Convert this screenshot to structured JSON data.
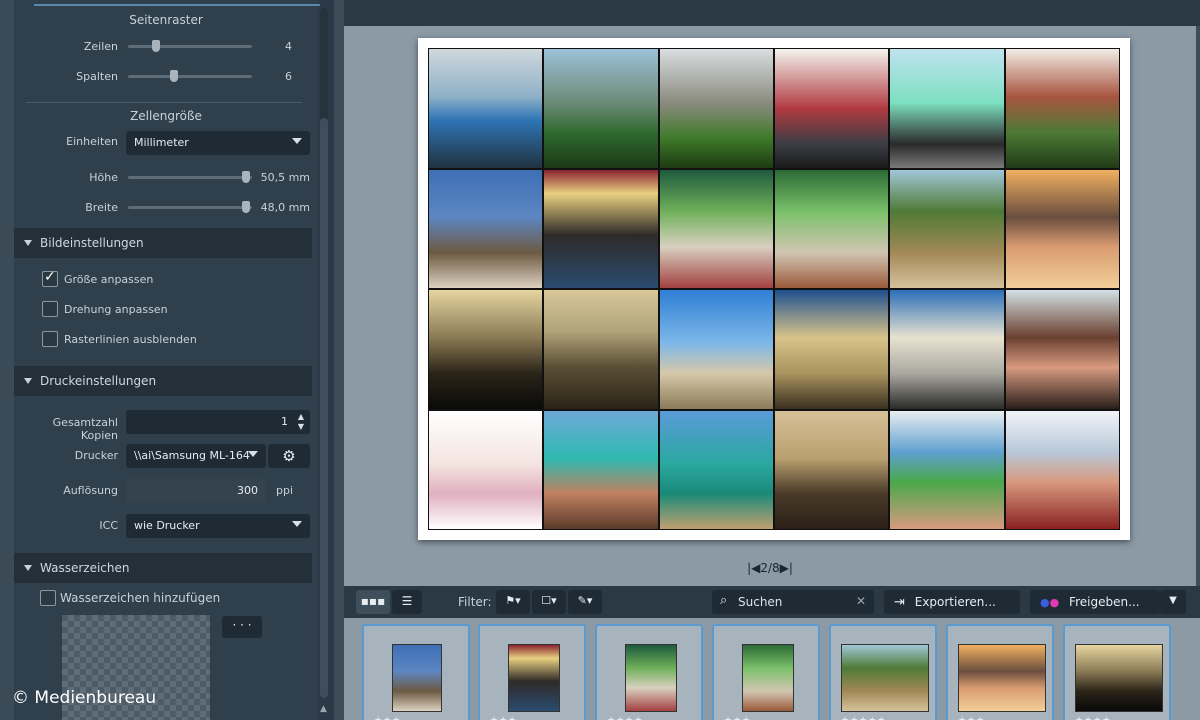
{
  "sidebar": {
    "raster_title": "Seitenraster",
    "rows_label": "Zeilen",
    "rows_value": "4",
    "rows_level": 0.2,
    "cols_label": "Spalten",
    "cols_value": "6",
    "cols_level": 0.35,
    "cellsize_title": "Zellengröße",
    "units_label": "Einheiten",
    "units_value": "Millimeter",
    "height_label": "Höhe",
    "height_value": "50,5 mm",
    "width_label": "Breite",
    "width_value": "48,0 mm",
    "image_section": "Bildeinstellungen",
    "fit_size": "Größe anpassen",
    "fit_rotation": "Drehung anpassen",
    "hide_gridlines": "Rasterlinien ausblenden",
    "print_section": "Druckeinstellungen",
    "copies_label": "Gesamtzahl Kopien",
    "copies_value": "1",
    "printer_label": "Drucker",
    "printer_value": "\\\\ai\\Samsung ML-164",
    "resolution_label": "Auflösung",
    "resolution_value": "300",
    "resolution_unit": "ppi",
    "icc_label": "ICC",
    "icc_value": "wie Drucker",
    "watermark_section": "Wasserzeichen",
    "add_watermark": "Wasserzeichen hinzufügen",
    "dots_label": "· · ·"
  },
  "copyright": "© Medienbureau",
  "pager": {
    "text": "|◀2/8▶|"
  },
  "toolbar": {
    "filter_label": "Filter:",
    "search_placeholder": "Suchen",
    "export_label": "Exportieren...",
    "share_label": "Freigeben..."
  },
  "thumbnails": [
    {
      "stars": "★★★"
    },
    {
      "stars": "★★★"
    },
    {
      "stars": "★★★★"
    },
    {
      "stars": "★★★"
    },
    {
      "stars": "★★★★★"
    },
    {
      "stars": "★★★"
    },
    {
      "stars": "★★★★"
    }
  ],
  "colors": {
    "accent_blue": "#5a9ad0",
    "panel_bg": "#2f3f4b",
    "canvas_bg": "#8c9aa6"
  }
}
